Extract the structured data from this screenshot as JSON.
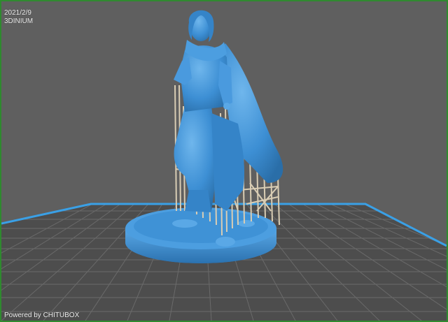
{
  "viewport": {
    "date": "2021/2/9",
    "brand": "3DINIUM",
    "footer": "Powered by CHITUBOX"
  },
  "colors": {
    "background": "#5f5f5f",
    "build_plate": "#4d4d4d",
    "plate_border": "#3aa0e6",
    "grid_line": "#6a6a6a",
    "model": "#3d8fd4",
    "supports": "#d9cdb4",
    "frame": "#2f8a2f"
  },
  "icons": {
    "model": "miniature-figure-icon",
    "supports": "support-structures-icon"
  }
}
